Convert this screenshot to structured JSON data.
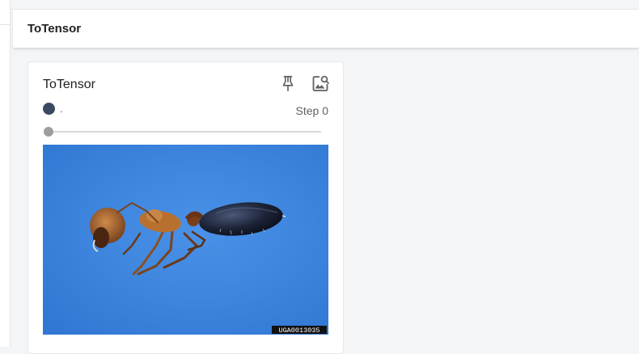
{
  "group": {
    "title": "ToTensor"
  },
  "card": {
    "title": "ToTensor",
    "run": {
      "name": ".",
      "color": "#3b4a63"
    },
    "step_label": "Step 0",
    "slider": {
      "value": 0
    },
    "actions": [
      {
        "icon": "pin-icon"
      },
      {
        "icon": "image-search-icon"
      }
    ],
    "image": {
      "watermark": "UGA0013035",
      "background_color": "#3b85de"
    }
  }
}
